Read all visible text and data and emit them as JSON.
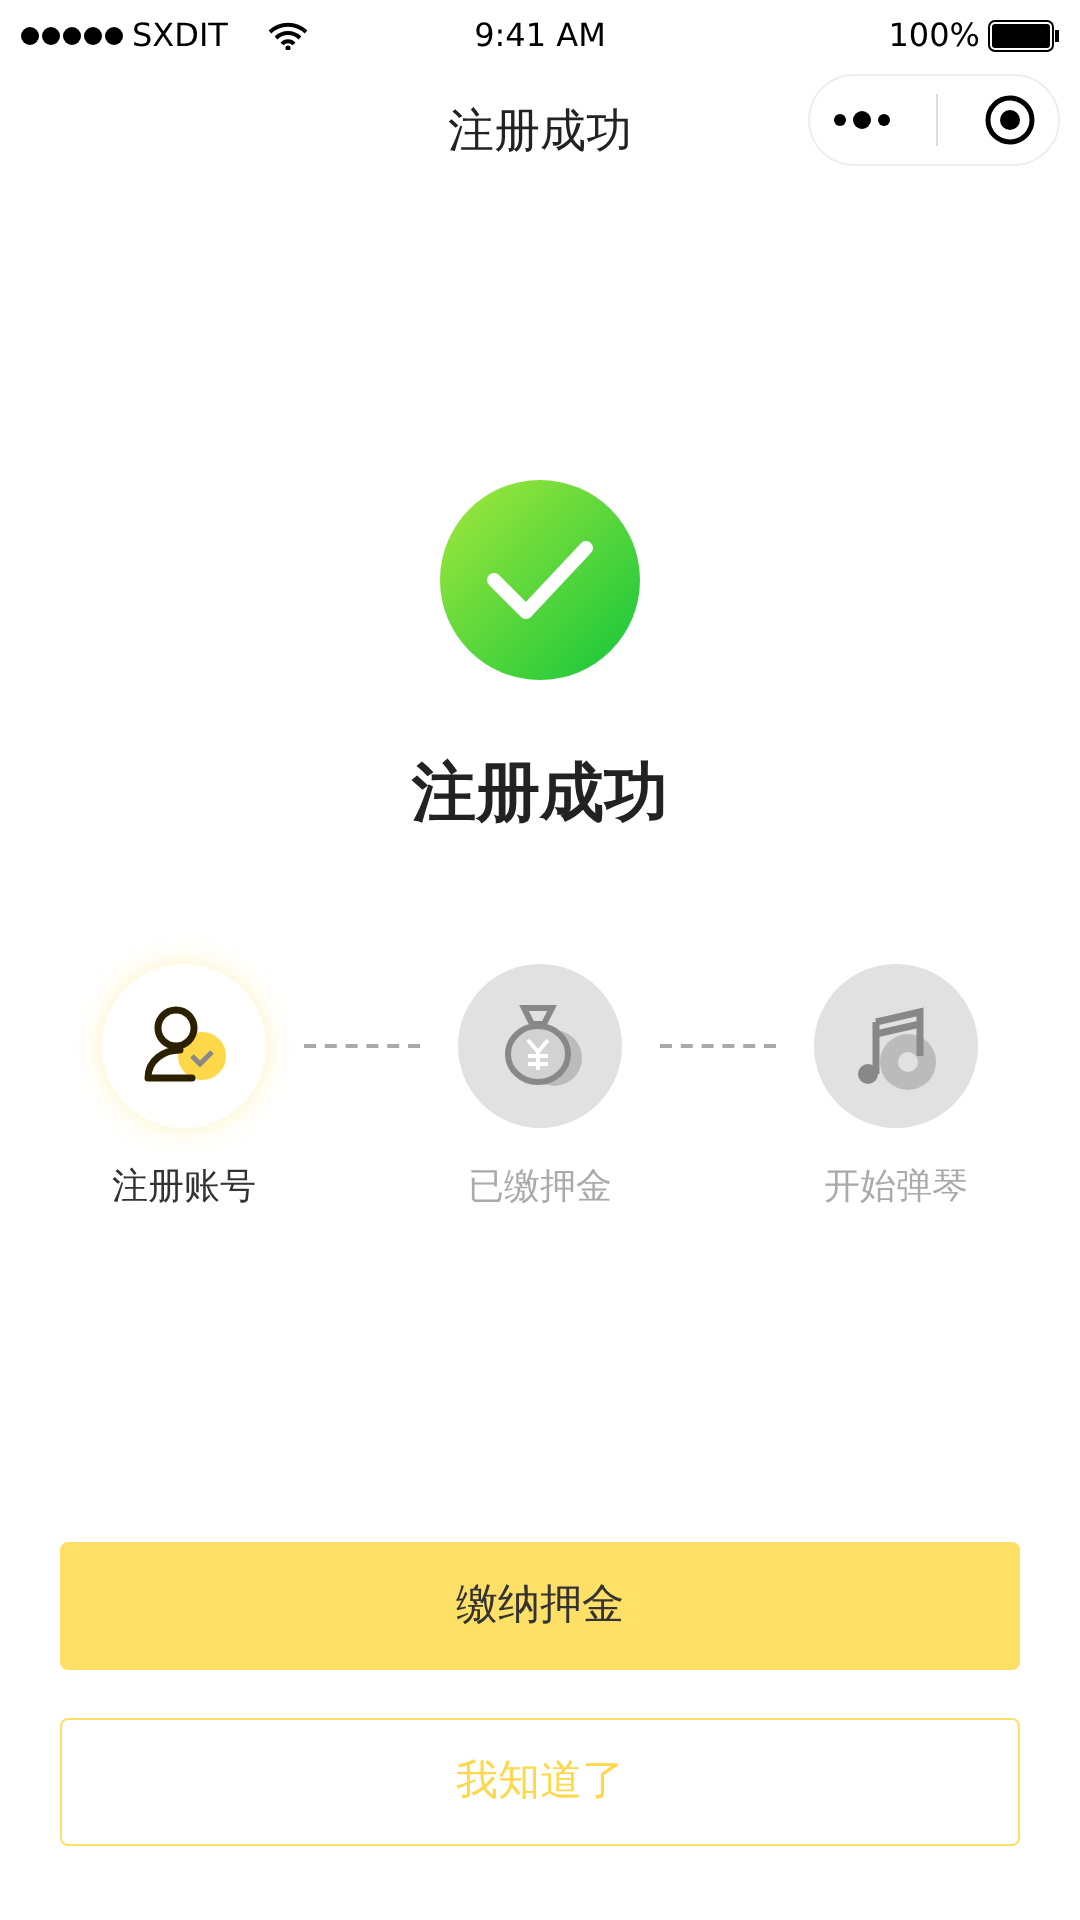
{
  "status_bar": {
    "carrier": "SXDIT",
    "time": "9:41 AM",
    "battery": "100%"
  },
  "nav": {
    "title": "注册成功"
  },
  "result": {
    "title": "注册成功"
  },
  "steps": [
    {
      "kind": "account",
      "label": "注册账号",
      "done": true
    },
    {
      "kind": "deposit",
      "label": "已缴押金",
      "done": false
    },
    {
      "kind": "music",
      "label": "开始弹琴",
      "done": false
    }
  ],
  "buttons": [
    {
      "kind": "primary",
      "label": "缴纳押金"
    },
    {
      "kind": "outline",
      "label": "我知道了"
    }
  ]
}
